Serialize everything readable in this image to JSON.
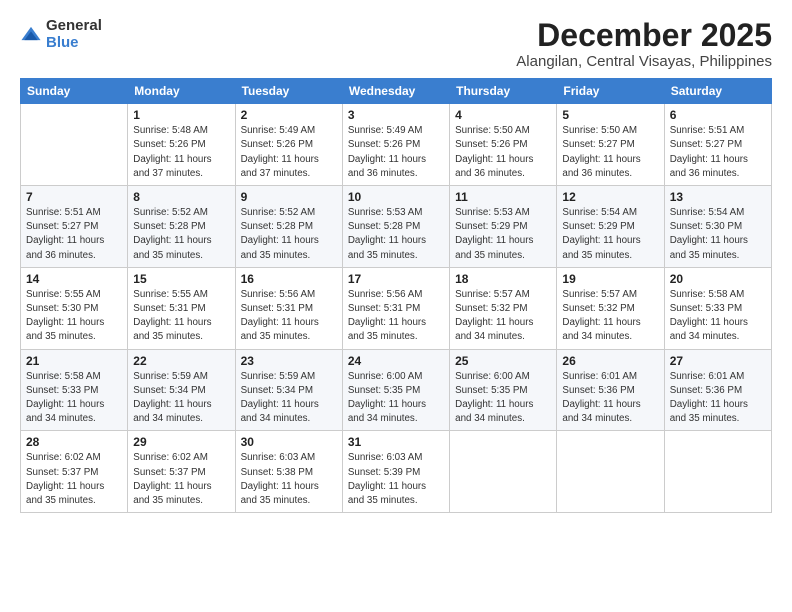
{
  "logo": {
    "general": "General",
    "blue": "Blue"
  },
  "title": "December 2025",
  "subtitle": "Alangilan, Central Visayas, Philippines",
  "weekdays": [
    "Sunday",
    "Monday",
    "Tuesday",
    "Wednesday",
    "Thursday",
    "Friday",
    "Saturday"
  ],
  "weeks": [
    [
      {
        "day": "",
        "info": ""
      },
      {
        "day": "1",
        "info": "Sunrise: 5:48 AM\nSunset: 5:26 PM\nDaylight: 11 hours\nand 37 minutes."
      },
      {
        "day": "2",
        "info": "Sunrise: 5:49 AM\nSunset: 5:26 PM\nDaylight: 11 hours\nand 37 minutes."
      },
      {
        "day": "3",
        "info": "Sunrise: 5:49 AM\nSunset: 5:26 PM\nDaylight: 11 hours\nand 36 minutes."
      },
      {
        "day": "4",
        "info": "Sunrise: 5:50 AM\nSunset: 5:26 PM\nDaylight: 11 hours\nand 36 minutes."
      },
      {
        "day": "5",
        "info": "Sunrise: 5:50 AM\nSunset: 5:27 PM\nDaylight: 11 hours\nand 36 minutes."
      },
      {
        "day": "6",
        "info": "Sunrise: 5:51 AM\nSunset: 5:27 PM\nDaylight: 11 hours\nand 36 minutes."
      }
    ],
    [
      {
        "day": "7",
        "info": "Sunrise: 5:51 AM\nSunset: 5:27 PM\nDaylight: 11 hours\nand 36 minutes."
      },
      {
        "day": "8",
        "info": "Sunrise: 5:52 AM\nSunset: 5:28 PM\nDaylight: 11 hours\nand 35 minutes."
      },
      {
        "day": "9",
        "info": "Sunrise: 5:52 AM\nSunset: 5:28 PM\nDaylight: 11 hours\nand 35 minutes."
      },
      {
        "day": "10",
        "info": "Sunrise: 5:53 AM\nSunset: 5:28 PM\nDaylight: 11 hours\nand 35 minutes."
      },
      {
        "day": "11",
        "info": "Sunrise: 5:53 AM\nSunset: 5:29 PM\nDaylight: 11 hours\nand 35 minutes."
      },
      {
        "day": "12",
        "info": "Sunrise: 5:54 AM\nSunset: 5:29 PM\nDaylight: 11 hours\nand 35 minutes."
      },
      {
        "day": "13",
        "info": "Sunrise: 5:54 AM\nSunset: 5:30 PM\nDaylight: 11 hours\nand 35 minutes."
      }
    ],
    [
      {
        "day": "14",
        "info": "Sunrise: 5:55 AM\nSunset: 5:30 PM\nDaylight: 11 hours\nand 35 minutes."
      },
      {
        "day": "15",
        "info": "Sunrise: 5:55 AM\nSunset: 5:31 PM\nDaylight: 11 hours\nand 35 minutes."
      },
      {
        "day": "16",
        "info": "Sunrise: 5:56 AM\nSunset: 5:31 PM\nDaylight: 11 hours\nand 35 minutes."
      },
      {
        "day": "17",
        "info": "Sunrise: 5:56 AM\nSunset: 5:31 PM\nDaylight: 11 hours\nand 35 minutes."
      },
      {
        "day": "18",
        "info": "Sunrise: 5:57 AM\nSunset: 5:32 PM\nDaylight: 11 hours\nand 34 minutes."
      },
      {
        "day": "19",
        "info": "Sunrise: 5:57 AM\nSunset: 5:32 PM\nDaylight: 11 hours\nand 34 minutes."
      },
      {
        "day": "20",
        "info": "Sunrise: 5:58 AM\nSunset: 5:33 PM\nDaylight: 11 hours\nand 34 minutes."
      }
    ],
    [
      {
        "day": "21",
        "info": "Sunrise: 5:58 AM\nSunset: 5:33 PM\nDaylight: 11 hours\nand 34 minutes."
      },
      {
        "day": "22",
        "info": "Sunrise: 5:59 AM\nSunset: 5:34 PM\nDaylight: 11 hours\nand 34 minutes."
      },
      {
        "day": "23",
        "info": "Sunrise: 5:59 AM\nSunset: 5:34 PM\nDaylight: 11 hours\nand 34 minutes."
      },
      {
        "day": "24",
        "info": "Sunrise: 6:00 AM\nSunset: 5:35 PM\nDaylight: 11 hours\nand 34 minutes."
      },
      {
        "day": "25",
        "info": "Sunrise: 6:00 AM\nSunset: 5:35 PM\nDaylight: 11 hours\nand 34 minutes."
      },
      {
        "day": "26",
        "info": "Sunrise: 6:01 AM\nSunset: 5:36 PM\nDaylight: 11 hours\nand 34 minutes."
      },
      {
        "day": "27",
        "info": "Sunrise: 6:01 AM\nSunset: 5:36 PM\nDaylight: 11 hours\nand 35 minutes."
      }
    ],
    [
      {
        "day": "28",
        "info": "Sunrise: 6:02 AM\nSunset: 5:37 PM\nDaylight: 11 hours\nand 35 minutes."
      },
      {
        "day": "29",
        "info": "Sunrise: 6:02 AM\nSunset: 5:37 PM\nDaylight: 11 hours\nand 35 minutes."
      },
      {
        "day": "30",
        "info": "Sunrise: 6:03 AM\nSunset: 5:38 PM\nDaylight: 11 hours\nand 35 minutes."
      },
      {
        "day": "31",
        "info": "Sunrise: 6:03 AM\nSunset: 5:39 PM\nDaylight: 11 hours\nand 35 minutes."
      },
      {
        "day": "",
        "info": ""
      },
      {
        "day": "",
        "info": ""
      },
      {
        "day": "",
        "info": ""
      }
    ]
  ]
}
